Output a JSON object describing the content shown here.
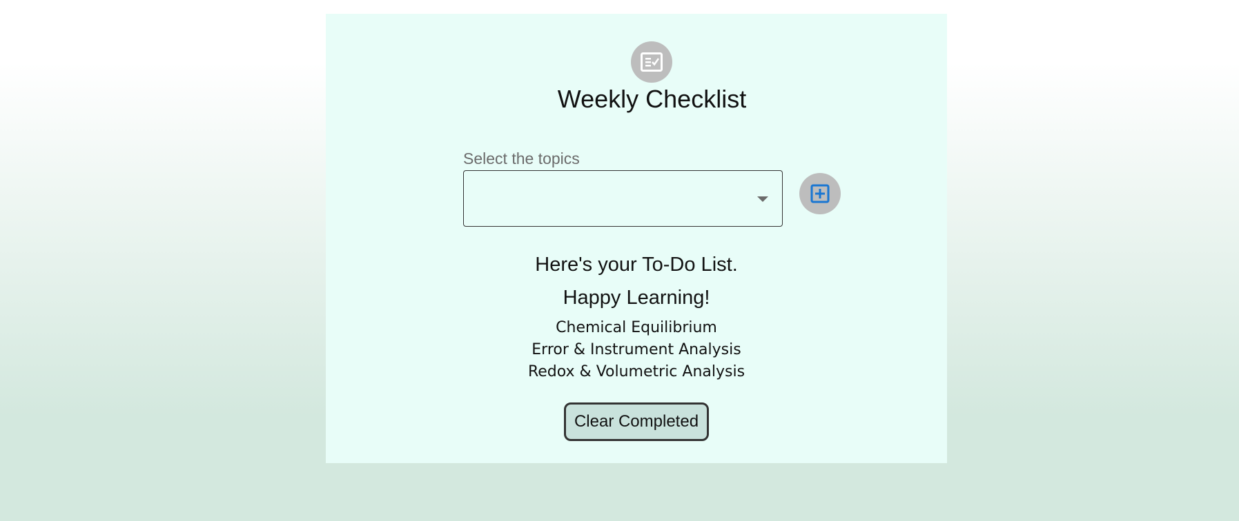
{
  "header": {
    "icon": "checklist-icon",
    "title": "Weekly Checklist"
  },
  "topic_select": {
    "label": "Select the topics",
    "value": "",
    "add_icon": "add-box-icon"
  },
  "todo": {
    "heading": "Here's your To-Do List.",
    "subheading": "Happy Learning!",
    "items": [
      "Chemical Equilibrium",
      "Error & Instrument Analysis",
      "Redox & Volumetric Analysis"
    ]
  },
  "actions": {
    "clear_label": "Clear Completed"
  },
  "colors": {
    "card_bg": "#e8fdf8",
    "icon_circle": "#bdbdbd",
    "add_icon": "#1976d2",
    "button_bg": "#c9e2dc"
  }
}
